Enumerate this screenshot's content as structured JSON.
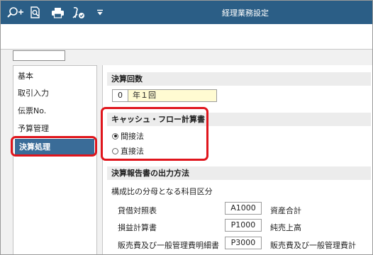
{
  "window": {
    "title": "経理業務設定"
  },
  "toolbar": {
    "icons": [
      "search-plus-icon",
      "search-page-icon",
      "printer-icon",
      "settings-check-icon",
      "dropdown-arrow-icon"
    ]
  },
  "nav": {
    "items": [
      {
        "label": "基本"
      },
      {
        "label": "取引入力"
      },
      {
        "label": "伝票No."
      },
      {
        "label": "予算管理"
      },
      {
        "label": "決算処理"
      }
    ],
    "selected": "決算処理"
  },
  "closing_count": {
    "heading": "決算回数",
    "number": "0",
    "text": "年１回"
  },
  "cashflow": {
    "heading": "キャッシュ・フロー計算書",
    "options": [
      {
        "label": "間接法",
        "selected": true
      },
      {
        "label": "直接法",
        "selected": false
      }
    ]
  },
  "report": {
    "heading": "決算報告書の出力方法",
    "subheading": "構成比の分母となる科目区分",
    "rows": [
      {
        "name": "貸借対照表",
        "code": "A1000",
        "account": "資産合計"
      },
      {
        "name": "損益計算書",
        "code": "P1000",
        "account": "純売上高"
      },
      {
        "name": "販売費及び一般管理費明細書",
        "code": "P3000",
        "account": "販売費及び一般管理費計"
      }
    ]
  },
  "colors": {
    "titlebar": "#2b5e86",
    "selected": "#3a6c98",
    "highlight": "#e0151c",
    "count_bg": "#fffbd2"
  }
}
